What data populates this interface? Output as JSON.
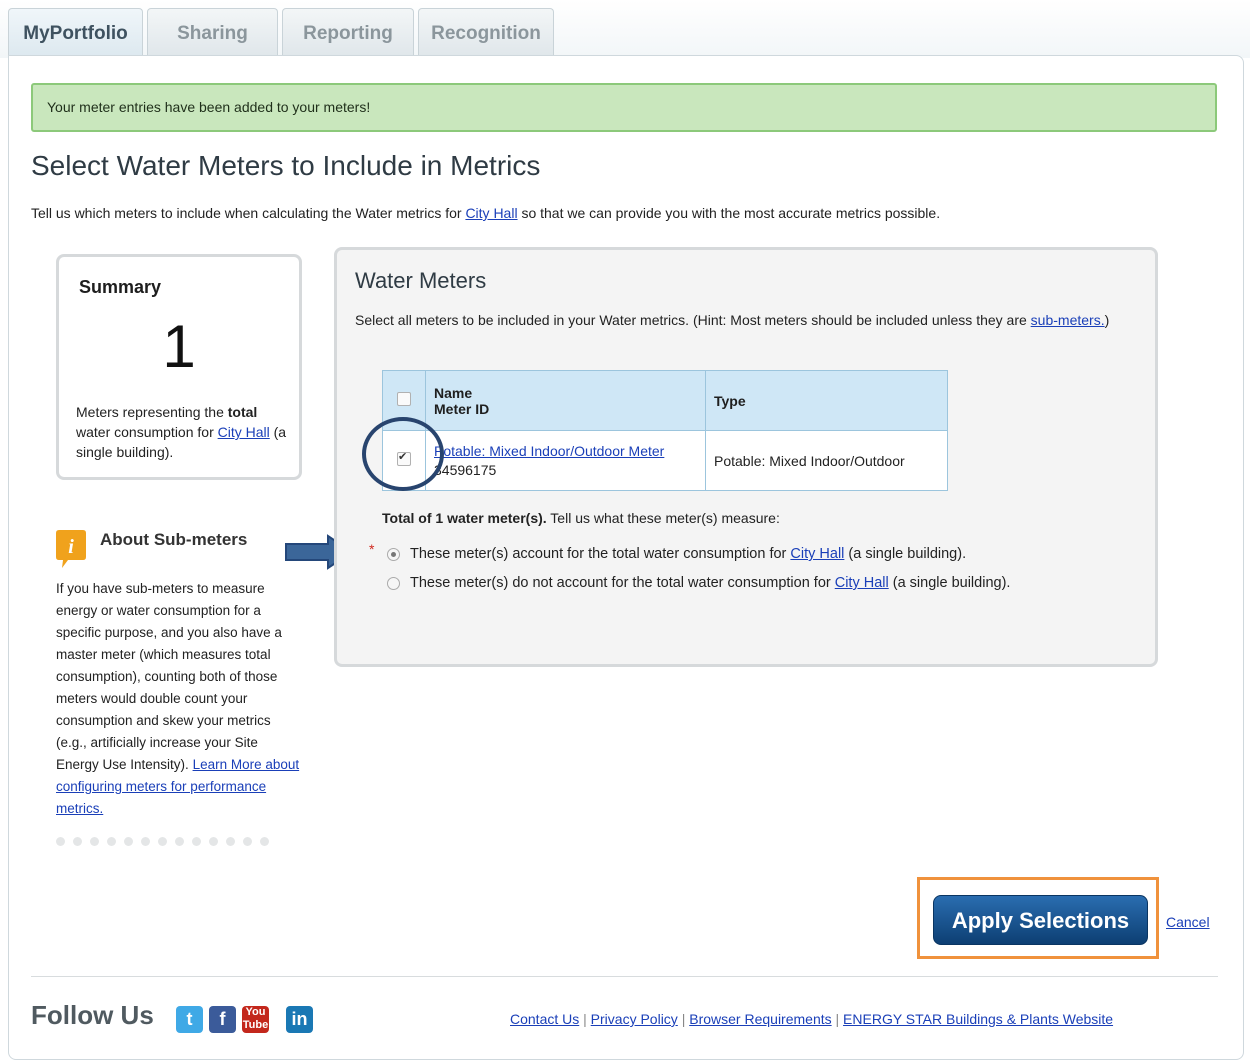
{
  "tabs": [
    "MyPortfolio",
    "Sharing",
    "Reporting",
    "Recognition"
  ],
  "alert": "Your meter entries have been added to your meters!",
  "page_title": "Select Water Meters to Include in Metrics",
  "intro": {
    "before": "Tell us which meters to include when calculating the Water metrics for ",
    "link": "City Hall",
    "after": " so that we can provide you with the most accurate metrics possible."
  },
  "summary": {
    "title": "Summary",
    "count": "1",
    "desc_1": "Meters representing the ",
    "desc_bold": "total",
    "desc_2": " water consumption for ",
    "desc_link": "City Hall",
    "desc_3": " (a single building)."
  },
  "about": {
    "title": "About Sub-meters",
    "text": "If you have sub-meters to measure energy or water consumption for a specific purpose, and you also have a master meter (which measures total consumption), counting both of those meters would double count your consumption and skew your metrics (e.g., artificially increase your Site Energy Use Intensity). ",
    "link": "Learn More about configuring meters for performance metrics."
  },
  "panel": {
    "title": "Water Meters",
    "hint_before": "Select all meters to be included in your Water metrics. (Hint: Most meters should be included unless they are ",
    "hint_link": "sub-meters.",
    "hint_after": ")",
    "col_name": "Name",
    "col_id": "Meter ID",
    "col_type": "Type",
    "rows": [
      {
        "name": "Potable: Mixed Indoor/Outdoor Meter",
        "id": "34596175",
        "type": "Potable: Mixed Indoor/Outdoor",
        "checked": true
      }
    ],
    "total_bold": "Total of 1 water meter(s).",
    "total_rest": " Tell us what these meter(s) measure:",
    "option_1_before": "These meter(s) account for the total water consumption for ",
    "option_2_before": "These meter(s) do not account for the total water consumption for ",
    "option_link": "City Hall",
    "option_after": " (a single building)."
  },
  "actions": {
    "apply": "Apply Selections",
    "cancel": "Cancel"
  },
  "footer": {
    "follow": "Follow Us",
    "links": [
      "Contact Us",
      "Privacy Policy",
      "Browser Requirements",
      "ENERGY STAR Buildings & Plants Website"
    ]
  },
  "colors": {
    "accent": "#0d3f73",
    "highlight": "#f0923c",
    "annotation": "#28446e",
    "alert_bg": "#c9e7bd"
  }
}
